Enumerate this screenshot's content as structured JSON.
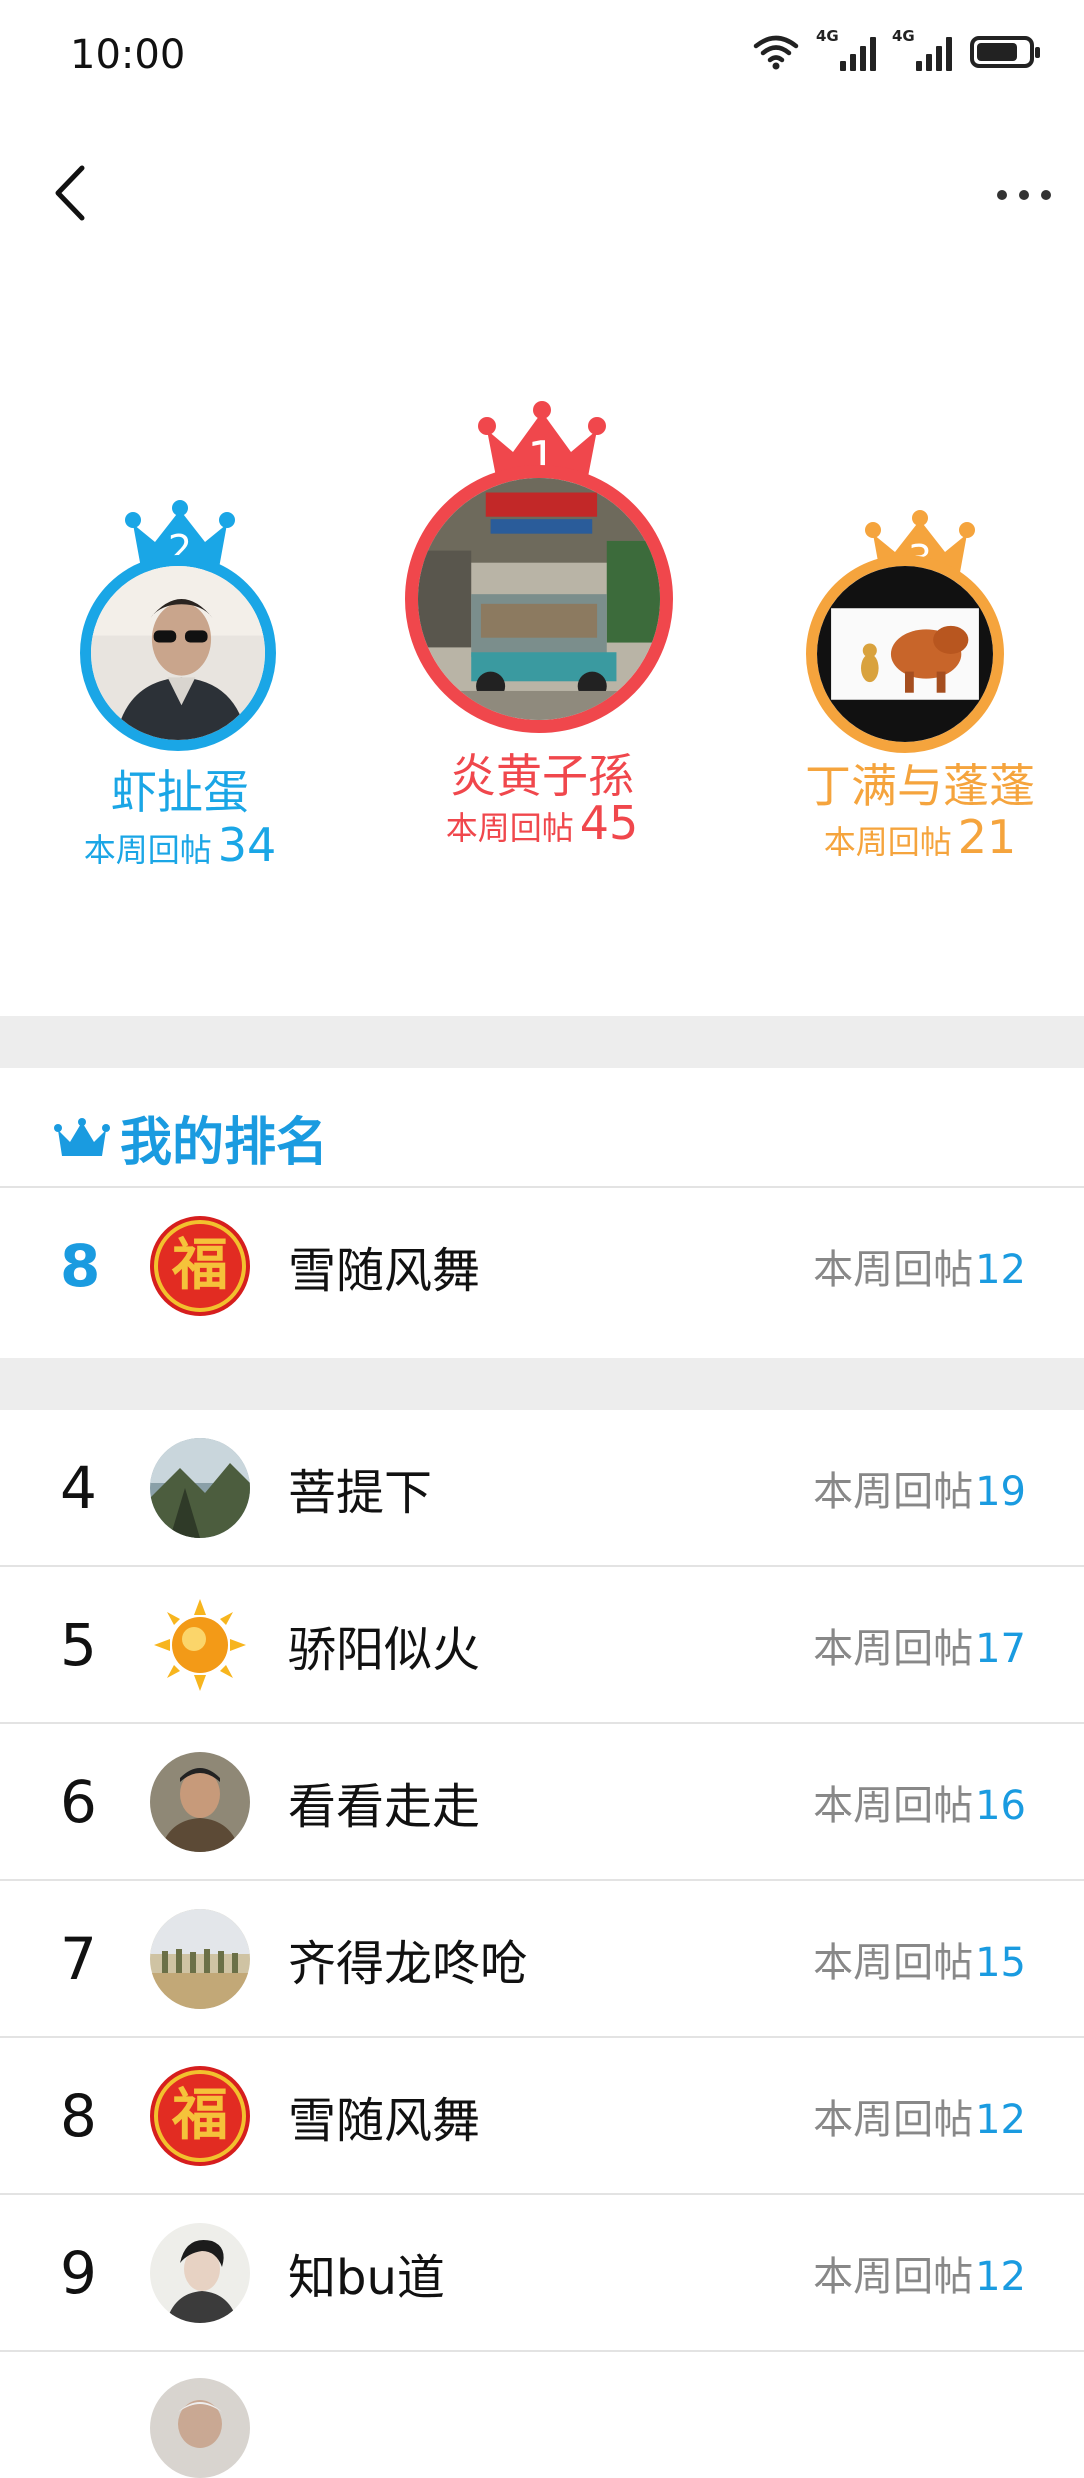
{
  "status_bar": {
    "time": "10:00",
    "network_a": "4G",
    "network_b": "4G",
    "battery_level": 0.8
  },
  "nav": {
    "back_icon": "chevron-left-icon",
    "more_icon": "more-dots-icon"
  },
  "podium": [
    {
      "rank": "1",
      "name": "炎黄子孫",
      "label": "本周回帖",
      "count": "45",
      "color": "#f0474c"
    },
    {
      "rank": "2",
      "name": "虾扯蛋",
      "label": "本周回帖",
      "count": "34",
      "color": "#1aa6e6"
    },
    {
      "rank": "3",
      "name": "丁满与蓬蓬",
      "label": "本周回帖",
      "count": "21",
      "color": "#f5a43d"
    }
  ],
  "my_ranking": {
    "title": "我的排名",
    "rank": "8",
    "name": "雪随风舞",
    "label": "本周回帖",
    "count": "12"
  },
  "list": [
    {
      "rank": "4",
      "name": "菩提下",
      "label": "本周回帖",
      "count": "19"
    },
    {
      "rank": "5",
      "name": "骄阳似火",
      "label": "本周回帖",
      "count": "17"
    },
    {
      "rank": "6",
      "name": "看看走走",
      "label": "本周回帖",
      "count": "16"
    },
    {
      "rank": "7",
      "name": "齐得龙咚呛",
      "label": "本周回帖",
      "count": "15"
    },
    {
      "rank": "8",
      "name": "雪随风舞",
      "label": "本周回帖",
      "count": "12"
    },
    {
      "rank": "9",
      "name": "知bu道",
      "label": "本周回帖",
      "count": "12"
    }
  ],
  "fu_glyph": "福"
}
